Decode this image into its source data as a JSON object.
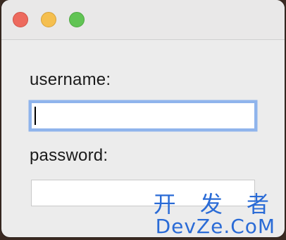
{
  "window": {
    "traffic_lights": {
      "close_color": "#ed6a5e",
      "minimize_color": "#f5bf4f",
      "zoom_color": "#61c454"
    }
  },
  "form": {
    "username_label": "username:",
    "username_value": "",
    "password_label": "password:",
    "password_value": "",
    "focus_ring_color": "#8fb4ec"
  },
  "watermark": {
    "line1": "开 发 者",
    "line2": "DevZe.CoM"
  }
}
